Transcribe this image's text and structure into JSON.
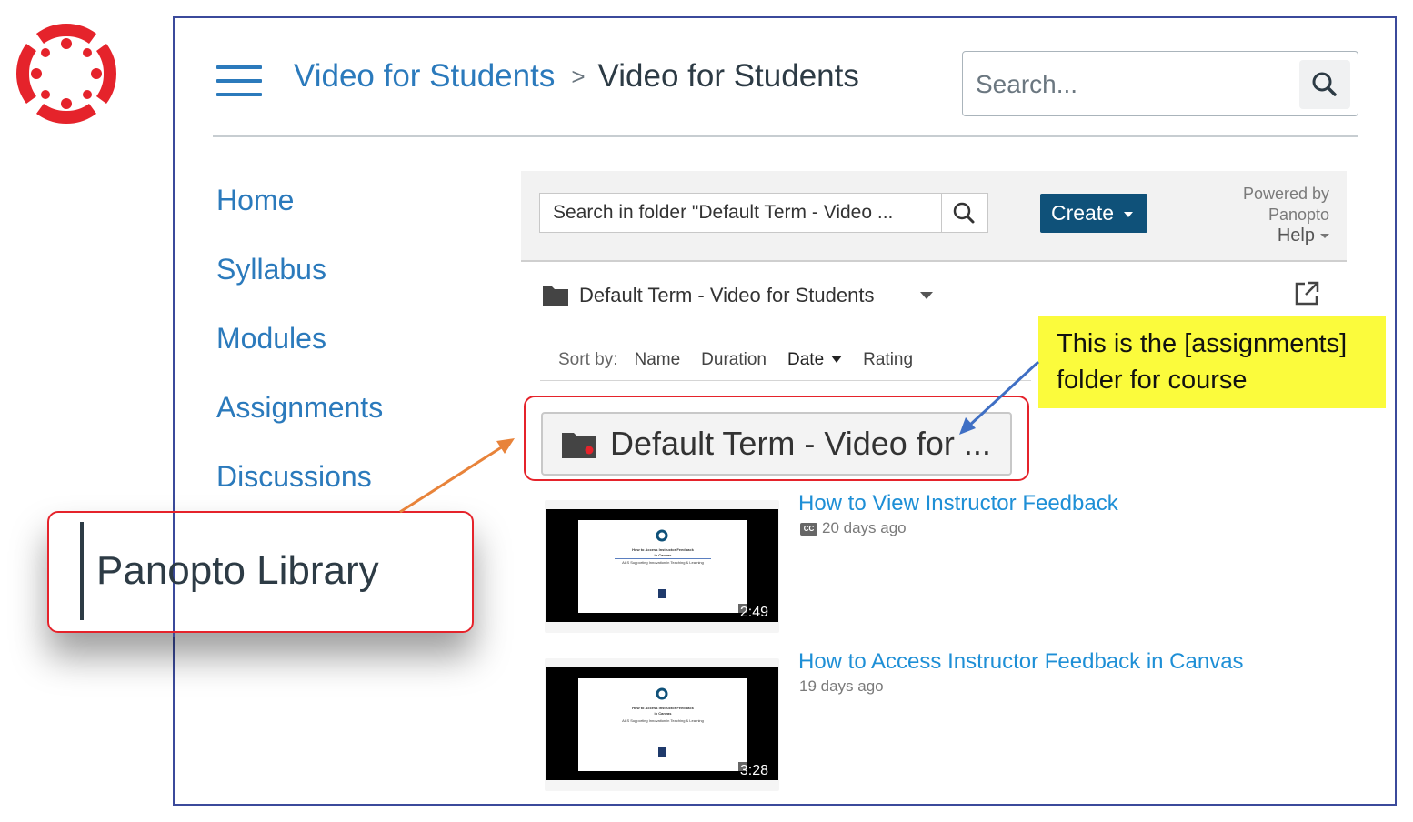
{
  "colors": {
    "canvas_red": "#e5232b",
    "link_blue": "#2b7abc",
    "panopto_link": "#1e8fd6",
    "create_bg": "#0f5179",
    "note_yellow": "#fbfb3c",
    "frame_blue": "#3b4a9b",
    "arrow_orange": "#e8833a",
    "arrow_blue": "#3f6fc4"
  },
  "icons": {
    "logo": "canvas-logo-icon",
    "menu": "hamburger-menu-icon",
    "search": "search-icon",
    "folder": "folder-icon",
    "popout": "open-in-new-window-icon",
    "captions": "closed-captions-icon"
  },
  "header": {
    "breadcrumb_course": "Video for Students",
    "breadcrumb_separator": ">",
    "breadcrumb_current": "Video for Students",
    "search_placeholder": "Search..."
  },
  "nav": {
    "items": [
      {
        "label": "Home"
      },
      {
        "label": "Syllabus"
      },
      {
        "label": "Modules"
      },
      {
        "label": "Assignments"
      },
      {
        "label": "Discussions"
      }
    ],
    "highlighted": "Panopto Library"
  },
  "panopto": {
    "folder_search_placeholder": "Search in folder \"Default Term - Video ...",
    "create_label": "Create",
    "powered_by_1": "Powered by",
    "powered_by_2": "Panopto",
    "help_label": "Help",
    "current_folder": "Default Term - Video for Students",
    "sort": {
      "label": "Sort by:",
      "options": [
        "Name",
        "Duration",
        "Date",
        "Rating"
      ],
      "active": "Date"
    },
    "subfolder": "Default Term - Video for ...",
    "videos": [
      {
        "title": "How to View Instructor Feedback",
        "cc_label": "CC",
        "date": "20 days ago",
        "duration": "2:49",
        "slide_title_1": "How to Access Instructor Feedback",
        "slide_title_2": "in Canvas",
        "slide_sub": "A&S Supporting Innovation in Teaching & Learning"
      },
      {
        "title": "How to Access Instructor Feedback in Canvas",
        "date": "19 days ago",
        "duration": "3:28",
        "slide_title_1": "How to Access Instructor Feedback",
        "slide_title_2": "in Canvas",
        "slide_sub": "A&S Supporting Innovation in Teaching & Learning"
      }
    ]
  },
  "annotation": {
    "note_line1": "This is the [assignments]",
    "note_line2": "folder for course"
  }
}
